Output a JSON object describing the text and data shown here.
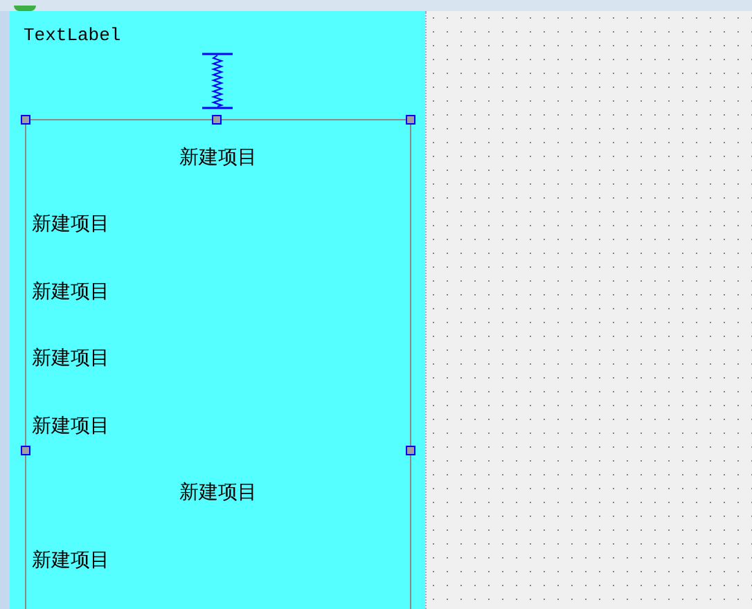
{
  "label": {
    "text": "TextLabel"
  },
  "list": {
    "items": [
      {
        "text": "新建项目",
        "kind": "centered"
      },
      {
        "text": "新建项目",
        "kind": "plain"
      },
      {
        "text": "新建项目",
        "kind": "plain"
      },
      {
        "text": "新建项目",
        "kind": "plain"
      },
      {
        "text": "新建项目",
        "kind": "plain"
      },
      {
        "text": "新建项目",
        "kind": "centered"
      },
      {
        "text": "新建项目",
        "kind": "plain"
      }
    ]
  }
}
